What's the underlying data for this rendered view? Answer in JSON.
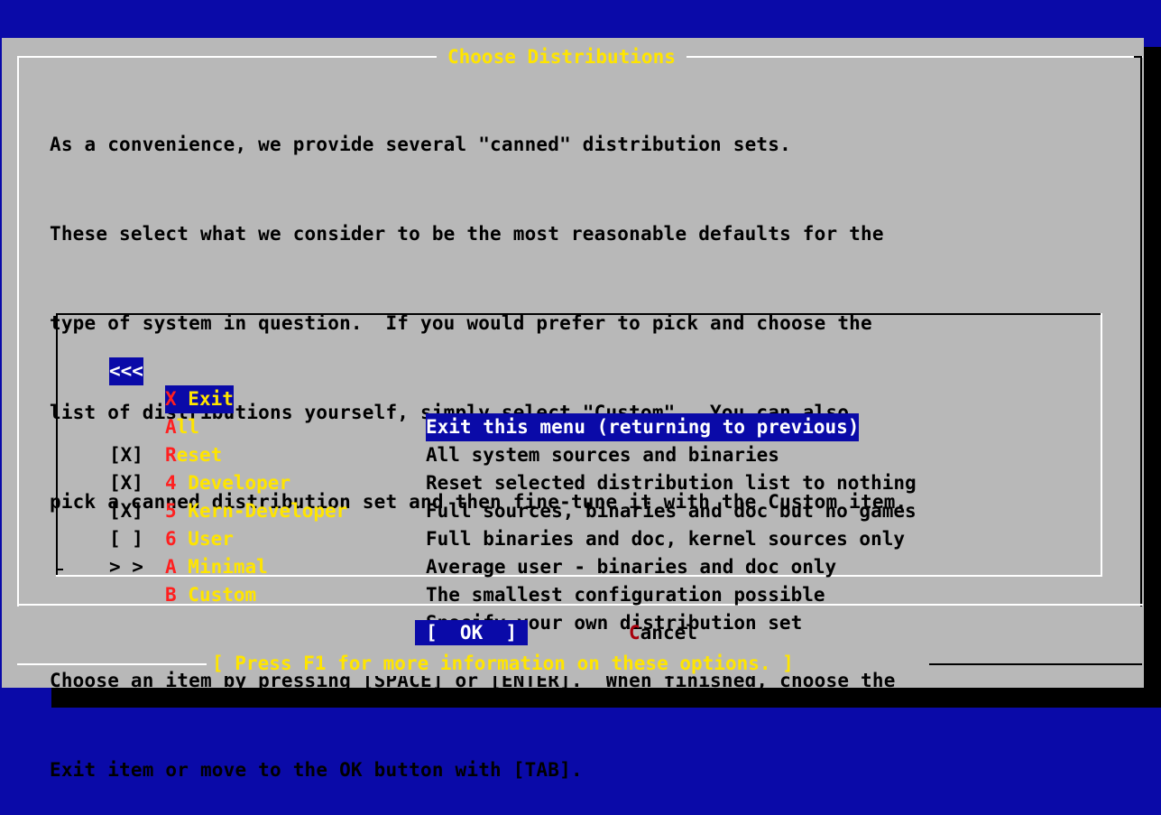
{
  "dialog": {
    "title": "Choose Distributions",
    "intro_lines": [
      "As a convenience, we provide several \"canned\" distribution sets.",
      "These select what we consider to be the most reasonable defaults for the",
      "type of system in question.  If you would prefer to pick and choose the",
      "list of distributions yourself, simply select \"Custom\".  You can also",
      "pick a canned distribution set and then fine-tune it with the Custom item.",
      "",
      "Choose an item by pressing [SPACE] or [ENTER].  When finished, choose the",
      "Exit item or move to the OK button with [TAB]."
    ],
    "menu": [
      {
        "check": "<<<",
        "hot": "X",
        "label": " Exit",
        "desc": "Exit this menu (returning to previous)",
        "selected": true
      },
      {
        "check": "",
        "hot": "A",
        "label": "ll",
        "desc": "All system sources and binaries"
      },
      {
        "check": "",
        "hot": "R",
        "label": "eset",
        "desc": "Reset selected distribution list to nothing"
      },
      {
        "check": "[X]",
        "hot": "4",
        "label": " Developer",
        "desc": "Full sources, binaries and doc but no games"
      },
      {
        "check": "[X]",
        "hot": "5",
        "label": " Kern-Developer",
        "desc": "Full binaries and doc, kernel sources only"
      },
      {
        "check": "[X]",
        "hot": "6",
        "label": " User",
        "desc": "Average user - binaries and doc only"
      },
      {
        "check": "[ ]",
        "hot": "A",
        "label": " Minimal",
        "desc": "The smallest configuration possible"
      },
      {
        "check": "> >",
        "hot": "B",
        "label": " Custom",
        "desc": "Specify your own distribution set"
      }
    ],
    "buttons": {
      "ok": "[  OK  ]",
      "cancel_hot": "C",
      "cancel_rest": "ancel"
    },
    "help_text": "[ Press F1 for more information on these options. ]"
  },
  "colors": {
    "background": "#0a0aa8",
    "dialog": "#b8b8b8",
    "title": "#ffe500",
    "hotkey": "#ff1f1f",
    "shadow": "#000000"
  }
}
